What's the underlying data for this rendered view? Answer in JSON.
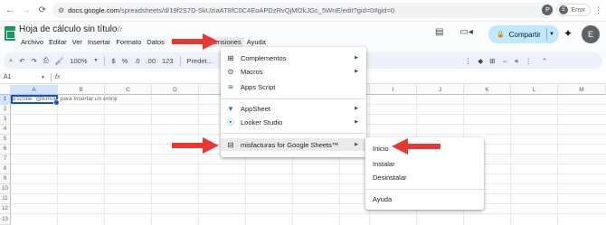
{
  "browser": {
    "url_host": "docs.google.com",
    "url_path": "/spreadsheets/d/19f2S7D-SkUziaAT8fC0C4EoAPDzRvQjMf2kJGc_5WnE/edit?gid=0#gid=0",
    "profile_letter": "P",
    "error_label": "Error",
    "error_avatar": "E"
  },
  "doc": {
    "title": "Hoja de cálculo sin título"
  },
  "menubar": [
    "Archivo",
    "Editar",
    "Ver",
    "Insertar",
    "Formato",
    "Datos",
    "Extensiones",
    "Ayuda"
  ],
  "share": {
    "label": "Compartir"
  },
  "user_avatar": "E",
  "toolbar": {
    "zoom": "100%",
    "currency": "$",
    "percent": "%",
    "dec_less": ".0",
    "dec_more": ".00",
    "number_format": "123",
    "font": "Predet..."
  },
  "formula_bar": {
    "cell": "A1",
    "fx": "fx"
  },
  "columns": [
    "A",
    "B",
    "C",
    "D",
    "E",
    "F",
    "G",
    "H",
    "I",
    "J",
    "K",
    "L",
    "M"
  ],
  "rows": [
    "1",
    "2",
    "3",
    "4",
    "5",
    "6",
    "7",
    "8",
    "9",
    "10",
    "11",
    "12",
    "13"
  ],
  "cell_hint": "Escribe \"@Emoji\" para insertar un emoji",
  "extensions_menu": {
    "items": [
      {
        "label": "Complementos",
        "icon": "addons-icon",
        "has_submenu": true
      },
      {
        "label": "Macros",
        "icon": "macros-icon",
        "has_submenu": true
      },
      {
        "label": "Apps Script",
        "icon": "apps-script-icon",
        "has_submenu": false
      },
      {
        "label": "AppSheet",
        "icon": "appsheet-icon",
        "has_submenu": true
      },
      {
        "label": "Looker Studio",
        "icon": "looker-studio-icon",
        "has_submenu": true
      },
      {
        "label": "misfacturas for Google Sheets™",
        "icon": "misfacturas-icon",
        "has_submenu": true
      }
    ]
  },
  "submenu": {
    "items": [
      "Inicio",
      "Instalar",
      "Desinstalar",
      "Ayuda"
    ]
  },
  "colors": {
    "accent": "#0b57d0",
    "share_bg": "#c2e7ff",
    "annotation_red": "#e53935",
    "sheets_green": "#0f9d58"
  }
}
